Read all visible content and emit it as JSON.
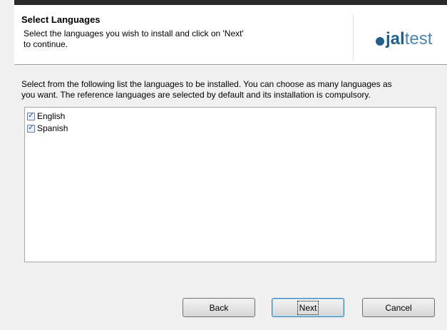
{
  "header": {
    "title": "Select Languages",
    "subtitle_line1": "Select the languages you wish to install and click on 'Next'",
    "subtitle_line2": "to continue.",
    "logo": {
      "part1": "jal",
      "part2": "test",
      "colors": {
        "dark": "#1f5f8c",
        "light": "#4a86b4"
      }
    }
  },
  "main": {
    "instructions_line1": "Select from the following list the languages to be installed. You can choose as many languages as",
    "instructions_line2": "you want. The reference languages are selected by default and its installation is compulsory.",
    "languages": [
      {
        "label": "English",
        "checked": true
      },
      {
        "label": "Spanish",
        "checked": true
      }
    ]
  },
  "footer": {
    "back_label": "Back",
    "next_label": "Next",
    "cancel_label": "Cancel"
  }
}
